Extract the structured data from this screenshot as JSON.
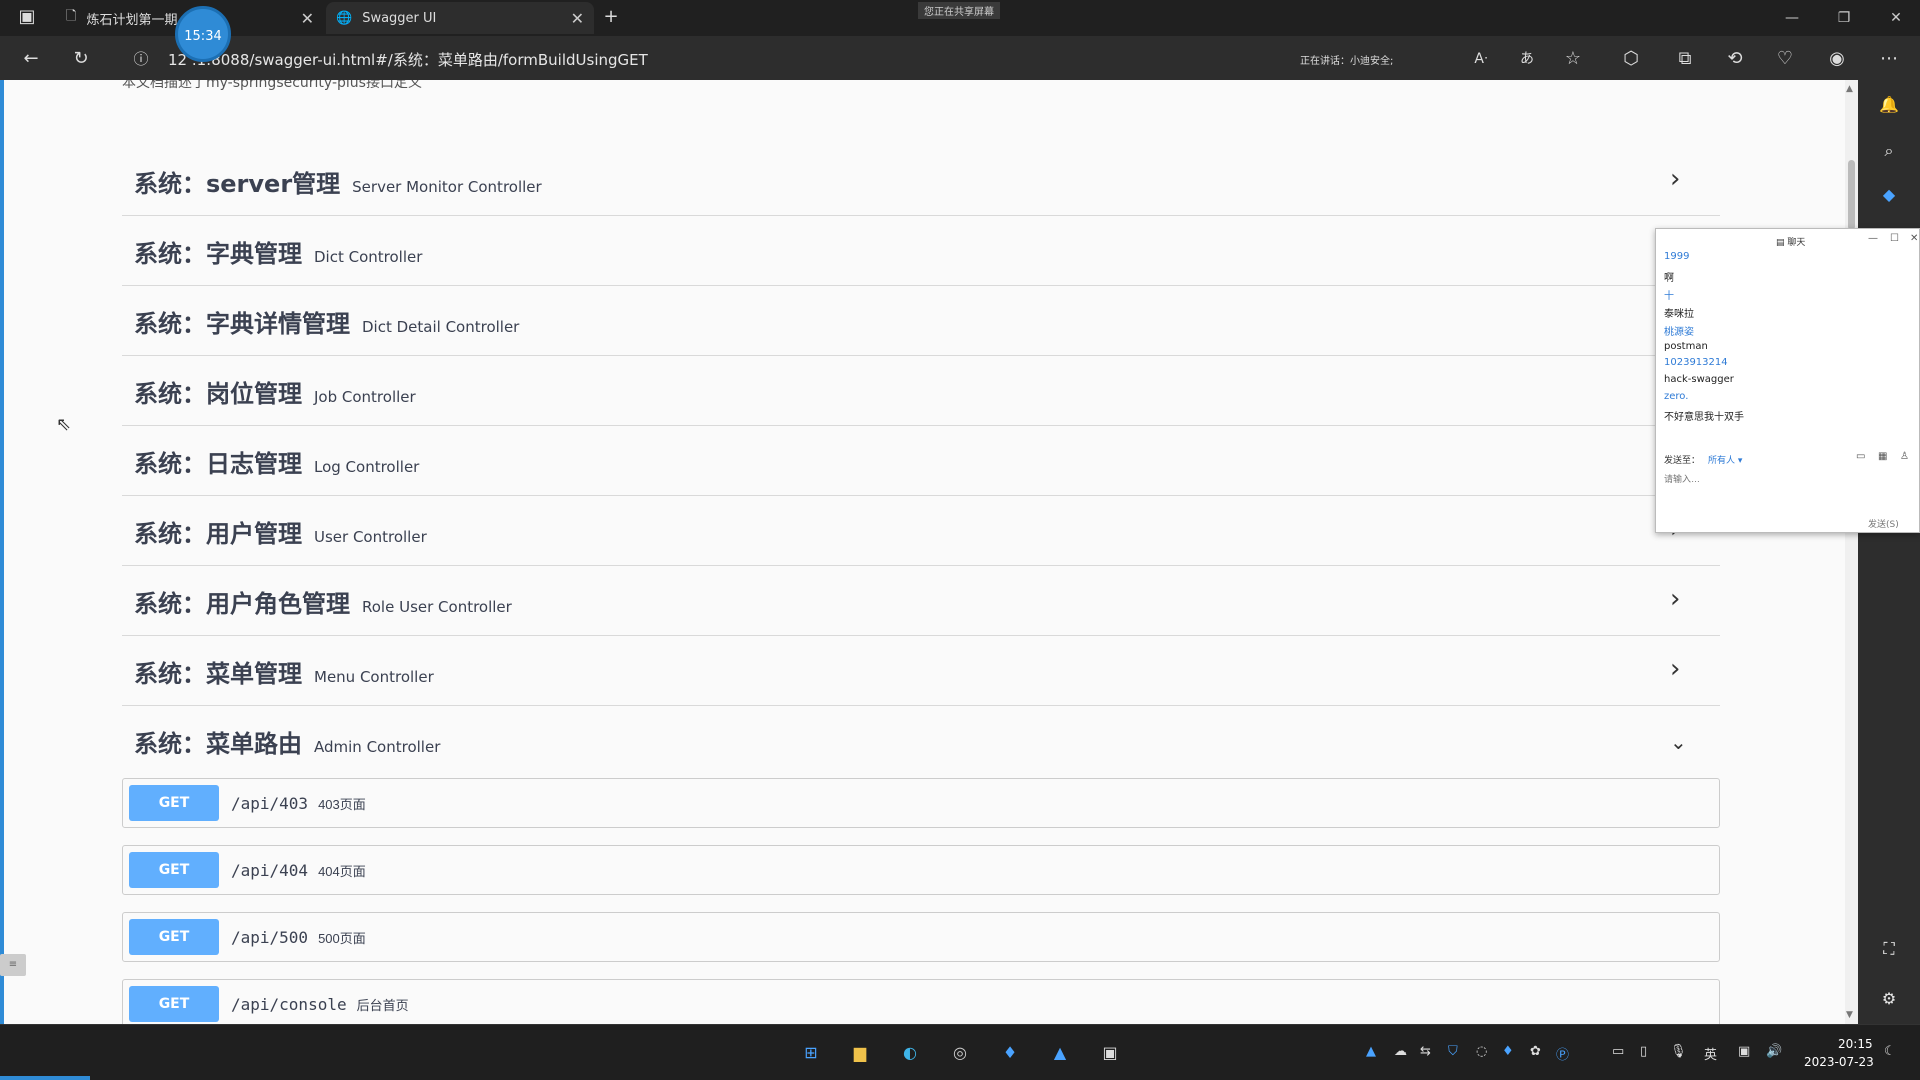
{
  "browser": {
    "tabs": [
      {
        "title": "炼石计划第一期",
        "icon": "document-icon"
      },
      {
        "title": "Swagger UI",
        "icon": "globe-icon"
      }
    ],
    "url": "127.0.0.1:8088/swagger-ui.html#/系统：菜单路由/formBuildUsingGET",
    "url_visible": "12     .1:8088/swagger-ui.html#/系统：菜单路由/formBuildUsingGET",
    "speaking": "正在讲话：小迪安全;",
    "sharing_badge": "您正在共享屏幕",
    "timer": "15:34",
    "accent_color": "#2f8bd6"
  },
  "swagger": {
    "intro_text": "本文档描述了my-springsecurity-plus接口定义",
    "get_color": "#61affe",
    "sections": [
      {
        "title": "系统：server管理",
        "desc": "Server Monitor Controller",
        "expanded": false
      },
      {
        "title": "系统：字典管理",
        "desc": "Dict Controller",
        "expanded": false
      },
      {
        "title": "系统：字典详情管理",
        "desc": "Dict Detail Controller",
        "expanded": false
      },
      {
        "title": "系统：岗位管理",
        "desc": "Job Controller",
        "expanded": false
      },
      {
        "title": "系统：日志管理",
        "desc": "Log Controller",
        "expanded": false
      },
      {
        "title": "系统：用户管理",
        "desc": "User Controller",
        "expanded": false
      },
      {
        "title": "系统：用户角色管理",
        "desc": "Role User Controller",
        "expanded": false
      },
      {
        "title": "系统：菜单管理",
        "desc": "Menu Controller",
        "expanded": false
      },
      {
        "title": "系统：菜单路由",
        "desc": "Admin Controller",
        "expanded": true
      }
    ],
    "operations": [
      {
        "method": "GET",
        "path": "/api/403",
        "summary": "403页面"
      },
      {
        "method": "GET",
        "path": "/api/404",
        "summary": "404页面"
      },
      {
        "method": "GET",
        "path": "/api/500",
        "summary": "500页面"
      },
      {
        "method": "GET",
        "path": "/api/console",
        "summary": "后台首页"
      }
    ]
  },
  "chat": {
    "title": "聊天",
    "messages": [
      {
        "kind": "name",
        "text": "1999"
      },
      {
        "kind": "msg",
        "text": "啊"
      },
      {
        "kind": "name",
        "text": "十"
      },
      {
        "kind": "msg",
        "text": "泰咪拉"
      },
      {
        "kind": "name",
        "text": "桃源姿"
      },
      {
        "kind": "msg",
        "text": "postman"
      },
      {
        "kind": "name",
        "text": "1023913214"
      },
      {
        "kind": "msg",
        "text": "hack-swagger"
      },
      {
        "kind": "name",
        "text": "zero."
      },
      {
        "kind": "msg",
        "text": "不好意思我十双手"
      }
    ],
    "send_to_label": "发送至：",
    "recipient": "所有人 ▾",
    "input_placeholder": "请输入…",
    "send_label": "发送(S)"
  },
  "taskbar": {
    "time": "20:15",
    "date": "2023-07-23",
    "ime": "英"
  }
}
